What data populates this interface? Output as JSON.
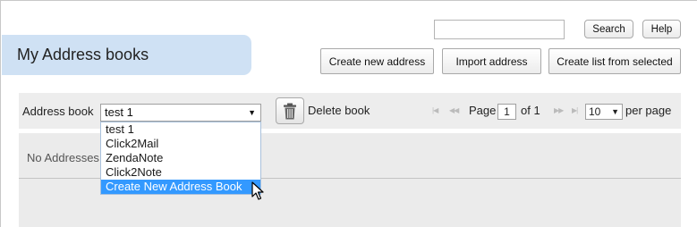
{
  "header": {
    "search_placeholder": "",
    "search_label": "Search",
    "help_label": "Help"
  },
  "title": "My Address books",
  "actions": {
    "create_new_address": "Create new address",
    "import_address": "Import address",
    "create_list_from_selected": "Create list from selected"
  },
  "toolbar": {
    "address_book_label": "Address book",
    "selected_book": "test 1",
    "delete_book_label": "Delete book",
    "page_label": "Page",
    "current_page": "1",
    "of_label": "of 1",
    "per_page_value": "10",
    "per_page_label": "per page"
  },
  "dropdown": {
    "options": [
      "test 1",
      "Click2Mail",
      "ZendaNote",
      "Click2Note",
      "Create New Address Book"
    ],
    "highlighted_option": "Create New Address Book"
  },
  "content": {
    "empty_message": "No Addresses"
  },
  "colors": {
    "title_tab": "#cfe1f4",
    "highlight": "#3399ff",
    "panel": "#ebebeb"
  },
  "icons": {
    "trash": "trash-icon",
    "pager": [
      "first-page-icon",
      "prev-page-icon",
      "next-page-icon",
      "last-page-icon"
    ]
  }
}
